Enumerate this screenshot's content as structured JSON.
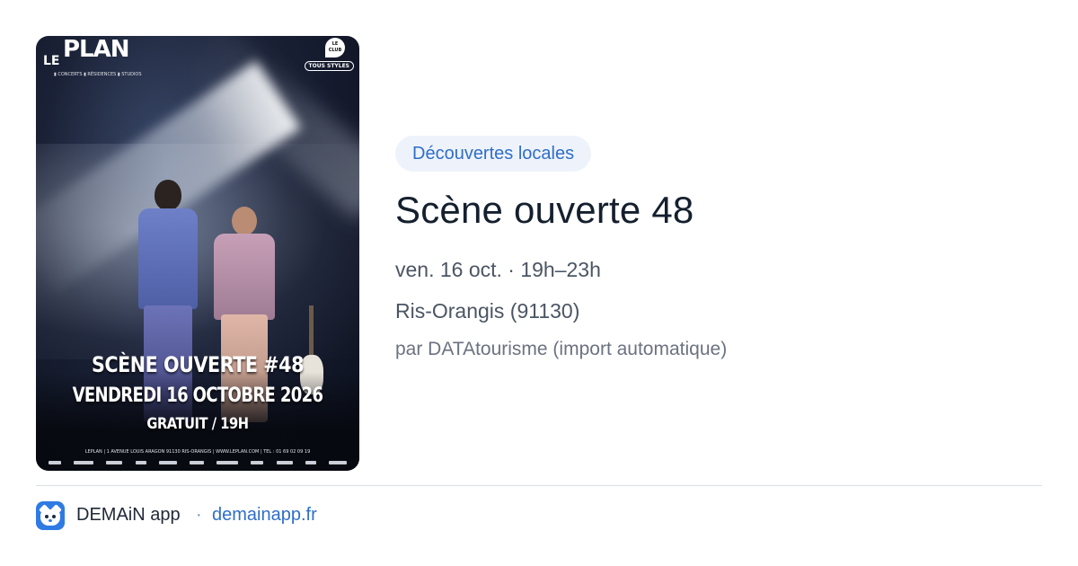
{
  "poster": {
    "logo_le": "LE",
    "logo_plan": "PLAN",
    "logo_sub": "▮ CONCERTS ▮ RÉSIDENCES ▮ STUDIOS",
    "club_label": "LE CLUB",
    "style_badge": "TOUS STYLES",
    "headline": "SCÈNE OUVERTE #48",
    "date_line": "VENDREDI 16 OCTOBRE 2026",
    "price_time": "GRATUIT / 19H",
    "address": "LEPLAN | 1 AVENUE LOUIS ARAGON 91130 RIS-ORANGIS | WWW.LEPLAN.COM | TEL : 01 69 02 09 19"
  },
  "event": {
    "category": "Découvertes locales",
    "title": "Scène ouverte 48",
    "datetime": "ven. 16 oct. · 19h–23h",
    "location": "Ris-Orangis (91130)",
    "source": "par DATAtourisme (import automatique)"
  },
  "footer": {
    "app_name": "DEMAiN app",
    "separator": "·",
    "url": "demainapp.fr",
    "icon": "fox-icon"
  },
  "colors": {
    "accent": "#2f6ec9",
    "tag_bg": "#eef3fb",
    "title": "#15202e",
    "muted": "#6b7280"
  }
}
